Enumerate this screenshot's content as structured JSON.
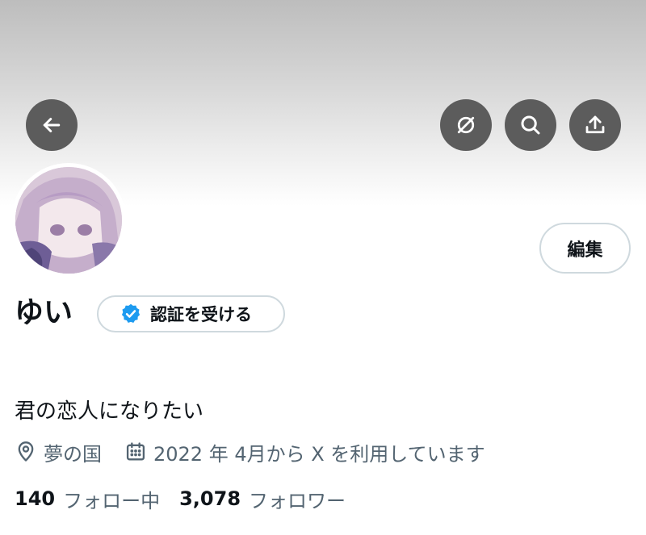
{
  "header": {
    "back_icon": "arrow-left-icon",
    "translate_icon": "translate-off-icon",
    "search_icon": "search-icon",
    "share_icon": "share-icon"
  },
  "profile": {
    "display_name": "ゆい",
    "edit_label": "編集",
    "verify_label": "認証を受ける",
    "verify_badge_color": "#1d9bf0",
    "bio": "君の恋人になりたい",
    "location": "夢の国",
    "joined": "2022 年 4月から X を利用しています",
    "following_count": "140",
    "following_label": "フォロー中",
    "followers_count": "3,078",
    "followers_label": "フォロワー"
  },
  "colors": {
    "button_overlay": "#5c5c5c",
    "text_primary": "#0f1419",
    "text_secondary": "#536471",
    "border": "#cfd9de"
  }
}
